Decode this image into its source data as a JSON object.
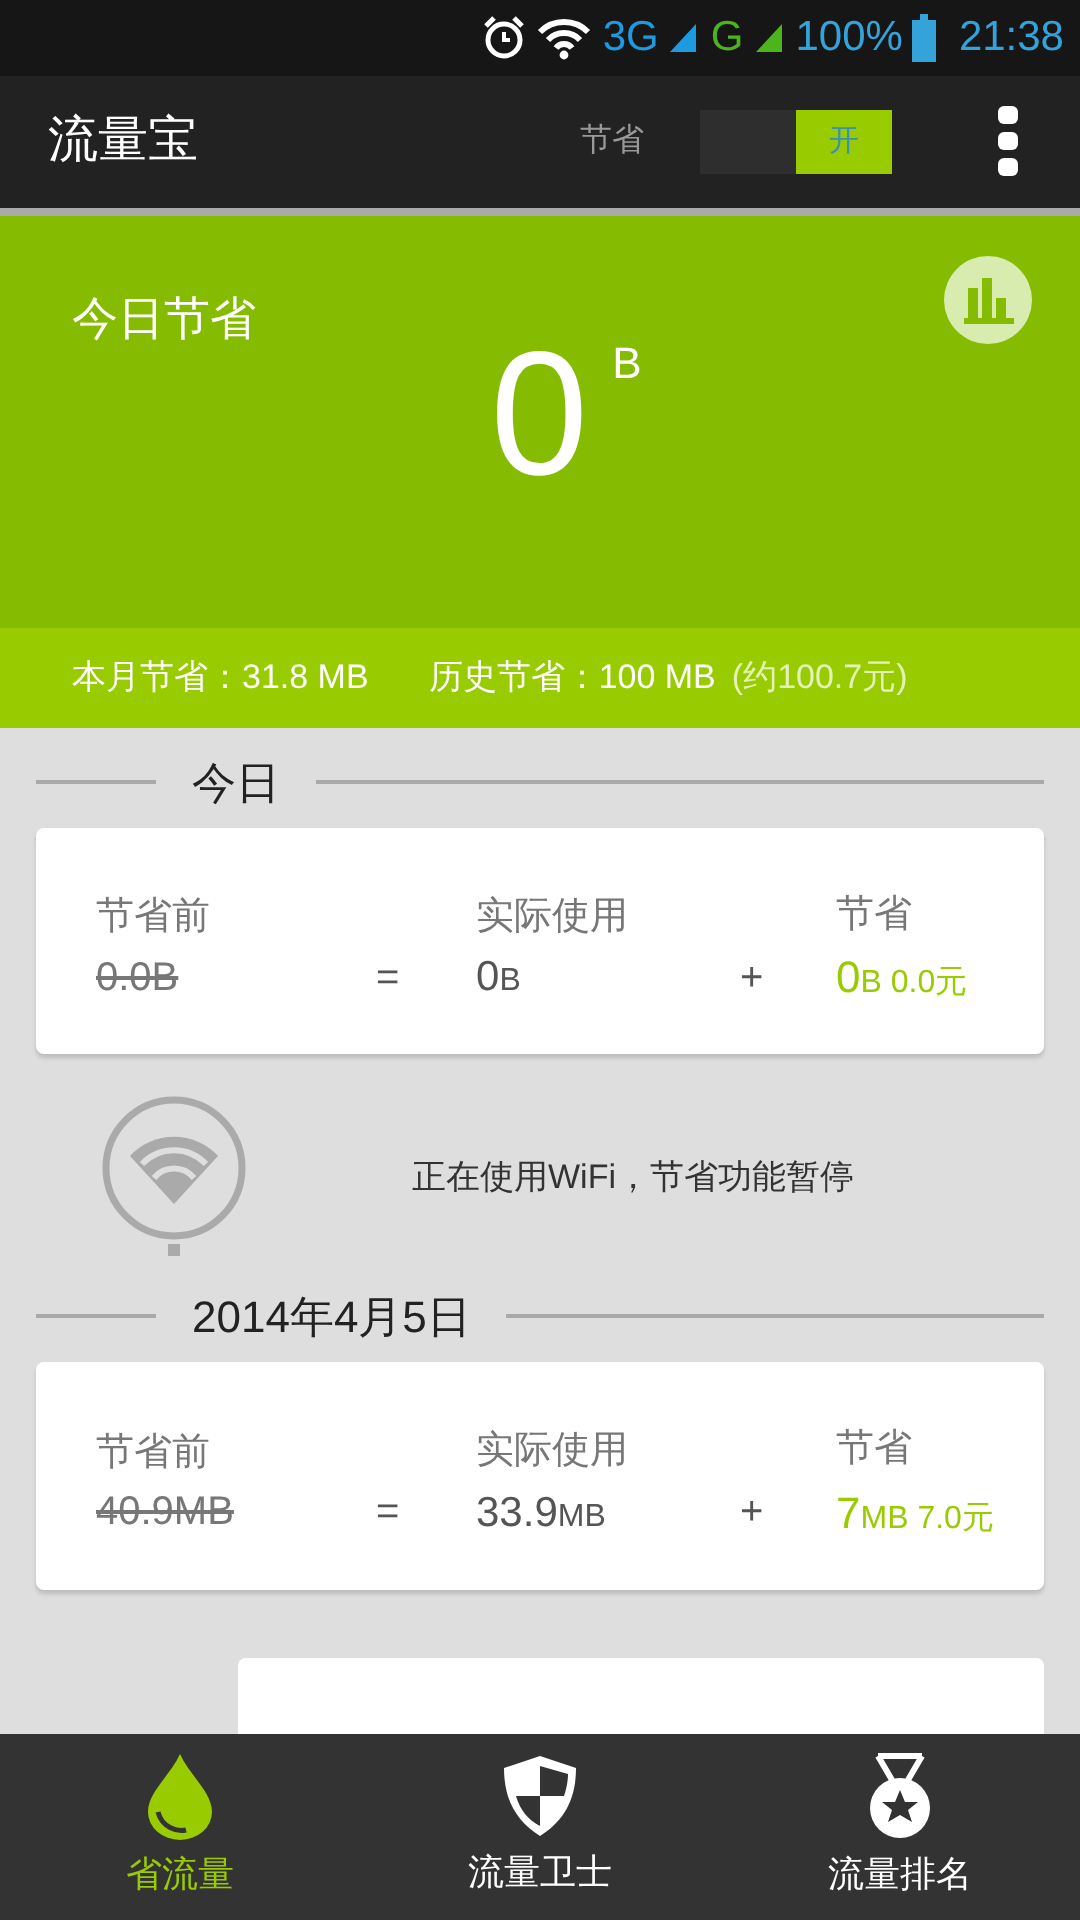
{
  "status_bar": {
    "network_1": "3G",
    "network_2": "G",
    "battery": "100%",
    "time": "21:38"
  },
  "app_bar": {
    "title": "流量宝",
    "toggle_label": "节省",
    "toggle": {
      "on_text": "开",
      "on": true
    }
  },
  "hero": {
    "title": "今日节省",
    "value": "0",
    "unit": "B"
  },
  "summary": {
    "month": "本月节省：31.8 MB",
    "history": "历史节省：100 MB",
    "history_money": "(约100.7元)"
  },
  "sections": [
    {
      "kind": "day",
      "heading": "今日",
      "before_label": "节省前",
      "before_value": "0.0B",
      "equals": "=",
      "actual_label": "实际使用",
      "actual_value": "0",
      "actual_unit": "B",
      "plus": "+",
      "saved_label": "节省",
      "saved_value": "0",
      "saved_unit": "B",
      "saved_money": "0.0元"
    },
    {
      "kind": "notice",
      "text": "正在使用WiFi，节省功能暂停"
    },
    {
      "kind": "day",
      "heading": "2014年4月5日",
      "before_label": "节省前",
      "before_value": "40.9MB",
      "equals": "=",
      "actual_label": "实际使用",
      "actual_value": "33.9",
      "actual_unit": "MB",
      "plus": "+",
      "saved_label": "节省",
      "saved_value": "7",
      "saved_unit": "MB",
      "saved_money": "7.0元"
    },
    {
      "kind": "partial_card"
    }
  ],
  "tabs": [
    {
      "label": "省流量",
      "kind": "drop",
      "selected": true
    },
    {
      "label": "流量卫士",
      "kind": "shield",
      "selected": false
    },
    {
      "label": "流量排名",
      "kind": "medal",
      "selected": false
    }
  ]
}
